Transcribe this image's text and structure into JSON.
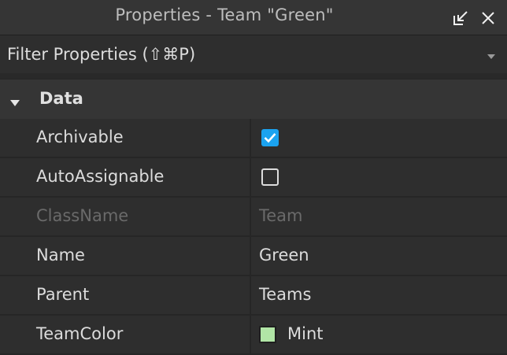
{
  "window": {
    "title": "Properties - Team \"Green\"",
    "undock_icon": "undock-icon",
    "close_icon": "close-icon"
  },
  "filter": {
    "placeholder": "Filter Properties (⇧⌘P)",
    "value": "",
    "dropdown_icon": "chevron-down-icon"
  },
  "section": {
    "label": "Data",
    "expanded": true
  },
  "properties": [
    {
      "name": "Archivable",
      "type": "checkbox",
      "checked": true
    },
    {
      "name": "AutoAssignable",
      "type": "checkbox",
      "checked": false
    },
    {
      "name": "ClassName",
      "type": "text",
      "value": "Team",
      "disabled": true
    },
    {
      "name": "Name",
      "type": "text",
      "value": "Green"
    },
    {
      "name": "Parent",
      "type": "text",
      "value": "Teams"
    },
    {
      "name": "TeamColor",
      "type": "color",
      "value": "Mint",
      "color": "#b1e5a6"
    }
  ],
  "colors": {
    "checkbox_checked": "#1ba3f0",
    "text": "#dcdcdc",
    "text_disabled": "#6a6a6a",
    "background": "#2e2e2e"
  }
}
